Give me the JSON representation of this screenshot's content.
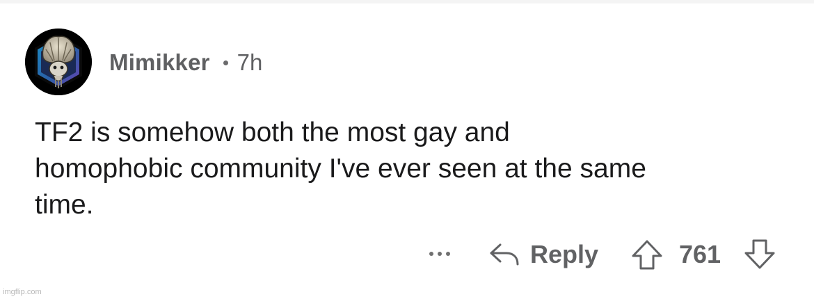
{
  "comment": {
    "username": "Mimikker",
    "timestamp": "7h",
    "body_lines": [
      "TF2 is somehow both the most gay and",
      "homophobic community I've ever seen at the same",
      "time."
    ]
  },
  "actions": {
    "more_icon": "more-options-icon",
    "reply_icon": "reply-arrow-icon",
    "reply_label": "Reply",
    "upvote_icon": "upvote-arrow-icon",
    "score": "761",
    "downvote_icon": "downvote-arrow-icon"
  },
  "watermark": "imgflip.com",
  "colors": {
    "username": "#5f6062",
    "body_text": "#1a1a1b",
    "action_gray": "#616264",
    "avatar_frame": "#1a7fb8"
  }
}
